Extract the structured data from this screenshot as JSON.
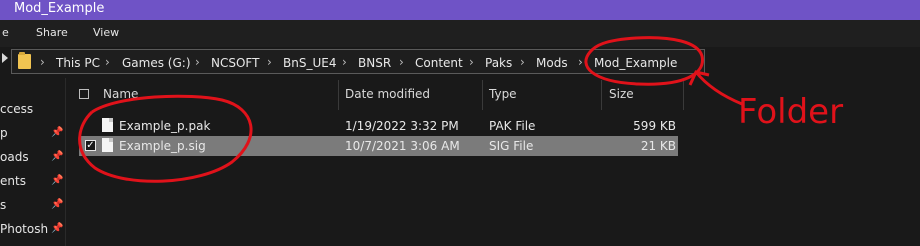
{
  "window": {
    "title": "Mod_Example"
  },
  "ribbon": {
    "tabs": [
      "e",
      "Share",
      "View"
    ]
  },
  "address": {
    "breadcrumbs": [
      "This PC",
      "Games (G:)",
      "NCSOFT",
      "BnS_UE4",
      "BNSR",
      "Content",
      "Paks",
      "Mods",
      "Mod_Example"
    ]
  },
  "nav": {
    "items": [
      "ccess",
      "p",
      "oads",
      "ents",
      "s",
      "Photosh"
    ]
  },
  "table": {
    "columns": [
      "Name",
      "Date modified",
      "Type",
      "Size"
    ],
    "rows": [
      {
        "name": "Example_p.pak",
        "date": "1/19/2022 3:32 PM",
        "type": "PAK File",
        "size": "599 KB",
        "selected": false
      },
      {
        "name": "Example_p.sig",
        "date": "10/7/2021 3:06 AM",
        "type": "SIG File",
        "size": "21 KB",
        "selected": true
      }
    ]
  },
  "annotation": {
    "label": "Folder",
    "color": "#e0121a"
  },
  "colors": {
    "titlebar": "#6f53c6",
    "selected_row": "#7b7b7b",
    "background": "#191919"
  }
}
